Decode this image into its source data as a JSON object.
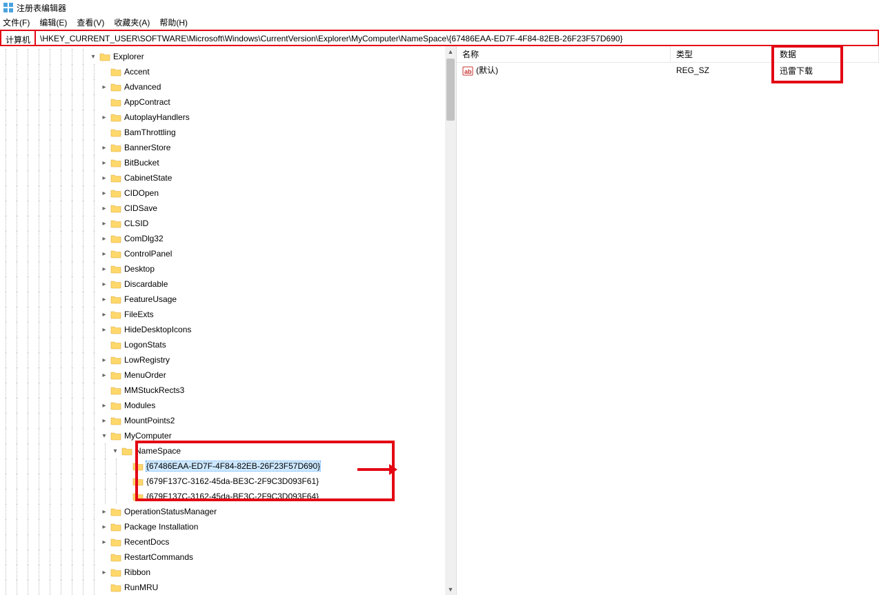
{
  "title": "注册表编辑器",
  "menu": {
    "file": "文件(F)",
    "edit": "编辑(E)",
    "view": "查看(V)",
    "favorites": "收藏夹(A)",
    "help": "帮助(H)"
  },
  "addr_label": "计算机",
  "addr_path": "\\HKEY_CURRENT_USER\\SOFTWARE\\Microsoft\\Windows\\CurrentVersion\\Explorer\\MyComputer\\NameSpace\\{67486EAA-ED7F-4F84-82EB-26F23F57D690}",
  "list_headers": {
    "name": "名称",
    "type": "类型",
    "data": "数据"
  },
  "list_row": {
    "name": "(默认)",
    "type": "REG_SZ",
    "data": "迅雷下载"
  },
  "tree": {
    "root": "Explorer",
    "items": [
      {
        "label": "Accent",
        "exp": ""
      },
      {
        "label": "Advanced",
        "exp": ">"
      },
      {
        "label": "AppContract",
        "exp": ""
      },
      {
        "label": "AutoplayHandlers",
        "exp": ">"
      },
      {
        "label": "BamThrottling",
        "exp": ""
      },
      {
        "label": "BannerStore",
        "exp": ">"
      },
      {
        "label": "BitBucket",
        "exp": ">"
      },
      {
        "label": "CabinetState",
        "exp": ">"
      },
      {
        "label": "CIDOpen",
        "exp": ">"
      },
      {
        "label": "CIDSave",
        "exp": ">"
      },
      {
        "label": "CLSID",
        "exp": ">"
      },
      {
        "label": "ComDlg32",
        "exp": ">"
      },
      {
        "label": "ControlPanel",
        "exp": ">"
      },
      {
        "label": "Desktop",
        "exp": ">"
      },
      {
        "label": "Discardable",
        "exp": ">"
      },
      {
        "label": "FeatureUsage",
        "exp": ">"
      },
      {
        "label": "FileExts",
        "exp": ">"
      },
      {
        "label": "HideDesktopIcons",
        "exp": ">"
      },
      {
        "label": "LogonStats",
        "exp": ""
      },
      {
        "label": "LowRegistry",
        "exp": ">"
      },
      {
        "label": "MenuOrder",
        "exp": ">"
      },
      {
        "label": "MMStuckRects3",
        "exp": ""
      },
      {
        "label": "Modules",
        "exp": ">"
      },
      {
        "label": "MountPoints2",
        "exp": ">"
      },
      {
        "label": "MyComputer",
        "exp": "v",
        "children": [
          {
            "label": "NameSpace",
            "exp": "v",
            "children": [
              {
                "label": "{67486EAA-ED7F-4F84-82EB-26F23F57D690}",
                "exp": "",
                "selected": true
              },
              {
                "label": "{679F137C-3162-45da-BE3C-2F9C3D093F61}",
                "exp": ""
              },
              {
                "label": "{679F137C-3162-45da-BE3C-2F9C3D093F64}",
                "exp": ""
              }
            ]
          }
        ]
      },
      {
        "label": "OperationStatusManager",
        "exp": ">"
      },
      {
        "label": "Package Installation",
        "exp": ">"
      },
      {
        "label": "RecentDocs",
        "exp": ">"
      },
      {
        "label": "RestartCommands",
        "exp": ""
      },
      {
        "label": "Ribbon",
        "exp": ">"
      },
      {
        "label": "RunMRU",
        "exp": ""
      }
    ]
  }
}
